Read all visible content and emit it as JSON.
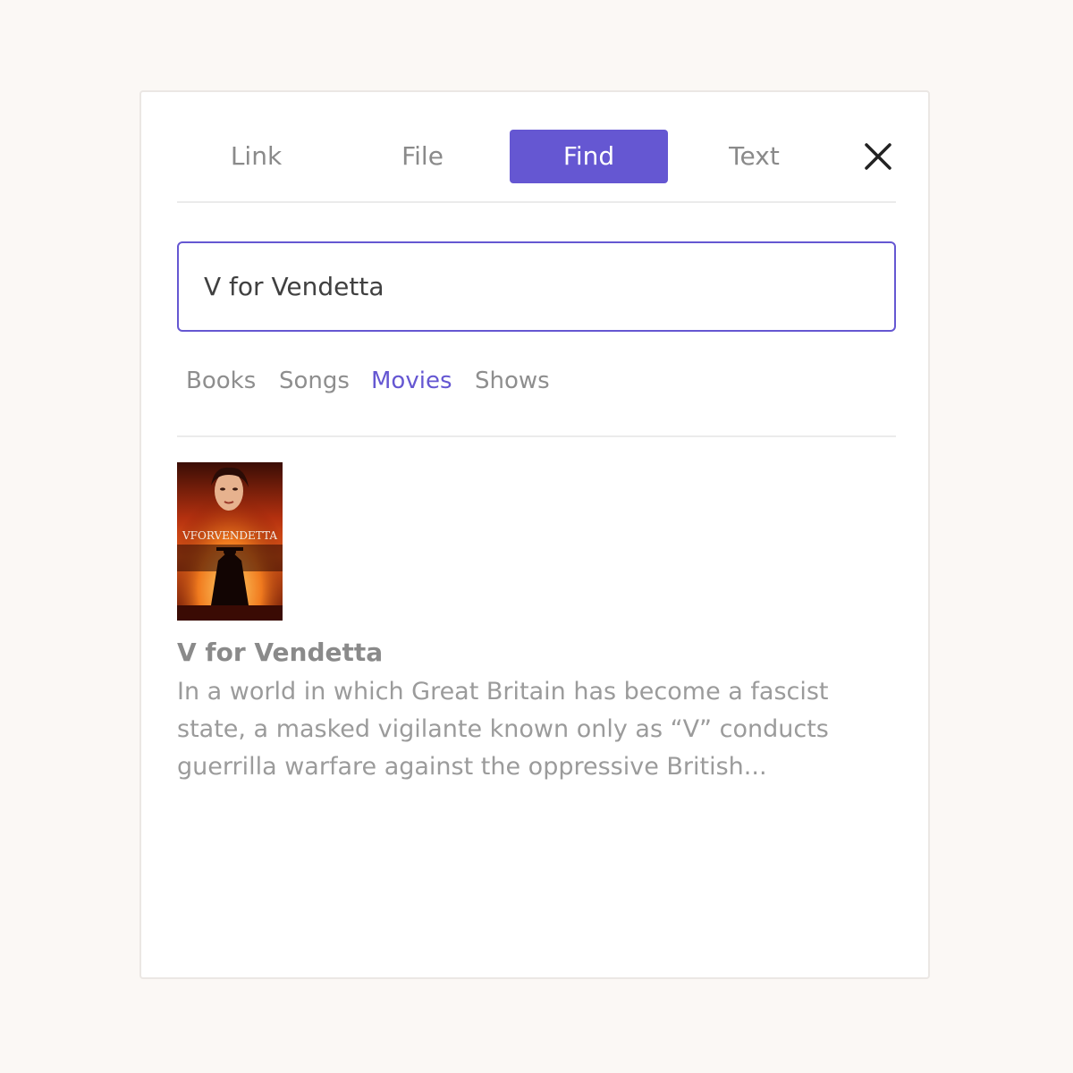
{
  "tabs": [
    {
      "label": "Link",
      "active": false
    },
    {
      "label": "File",
      "active": false
    },
    {
      "label": "Find",
      "active": true
    },
    {
      "label": "Text",
      "active": false
    }
  ],
  "search": {
    "value": "V for Vendetta"
  },
  "categories": [
    {
      "label": "Books",
      "active": false
    },
    {
      "label": "Songs",
      "active": false
    },
    {
      "label": "Movies",
      "active": true
    },
    {
      "label": "Shows",
      "active": false
    }
  ],
  "result": {
    "title": "V for Vendetta",
    "description": "In a world in which Great Britain has become a fascist state, a masked vigilante known only as “V” conducts guerrilla warfare against the oppressive British...",
    "poster_text": "VFORVENDETTA"
  },
  "colors": {
    "accent": "#6557d2",
    "background": "#fbf8f5",
    "muted_text": "#8a8a8a"
  },
  "icons": {
    "close": "close-icon"
  }
}
